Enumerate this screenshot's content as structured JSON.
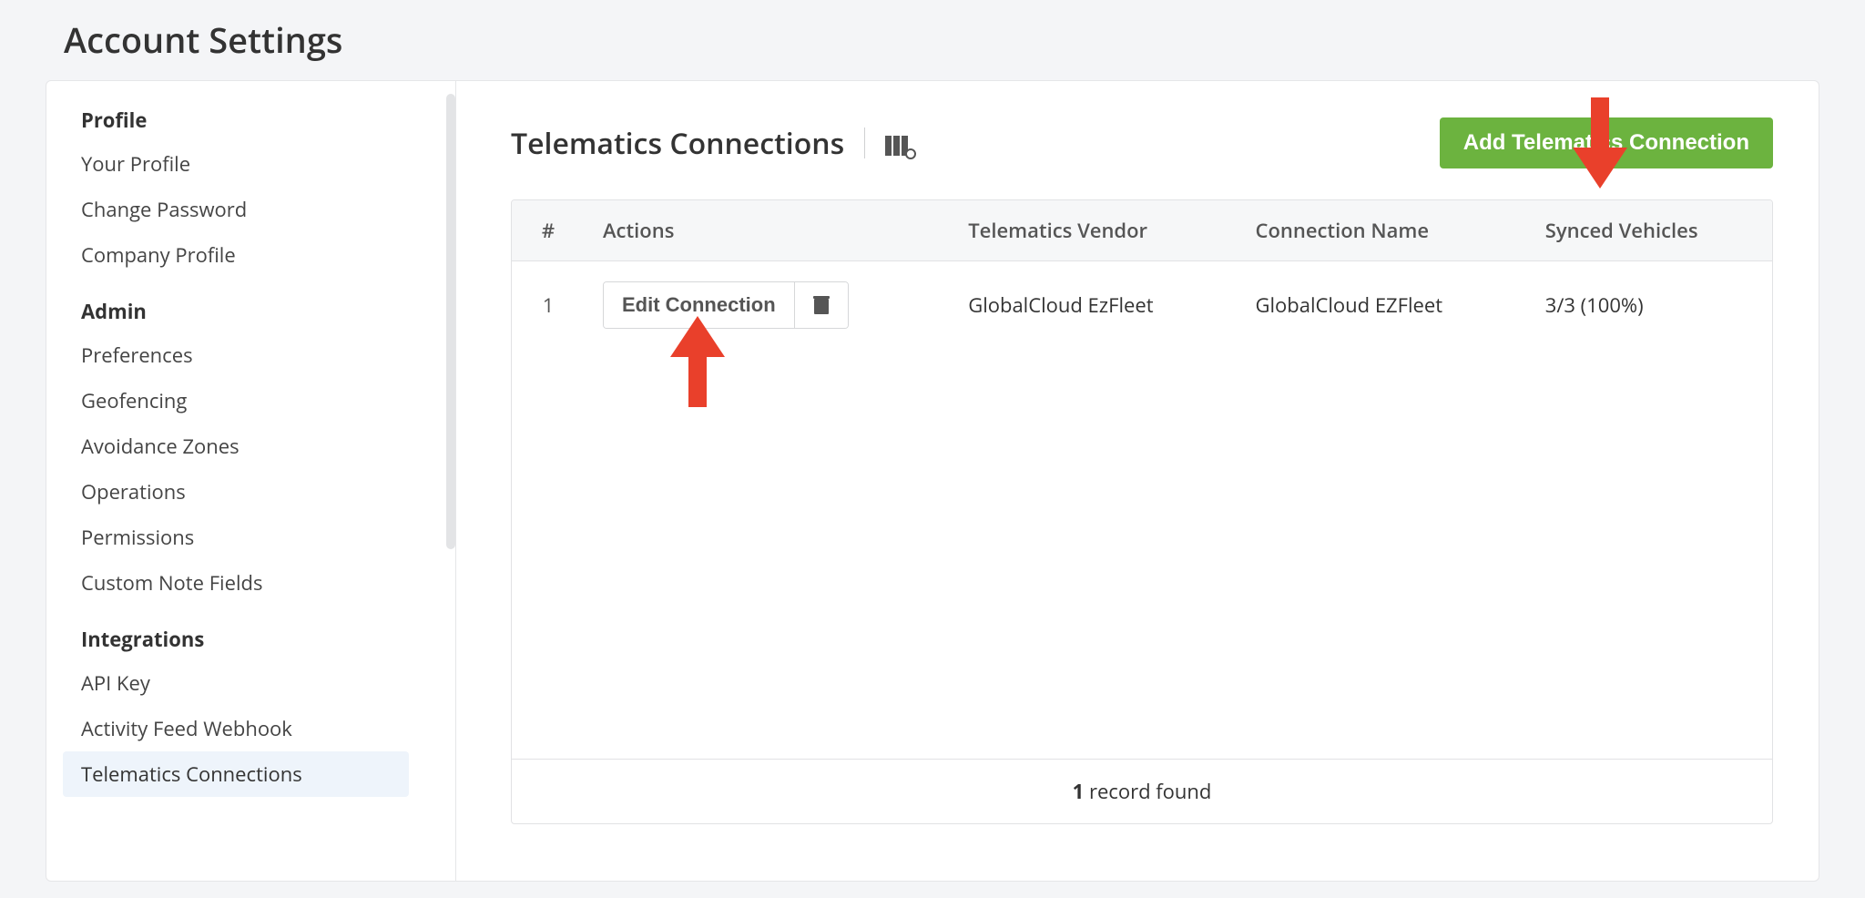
{
  "page_title": "Account Settings",
  "sidebar": {
    "groups": [
      {
        "heading": "Profile",
        "items": [
          {
            "label": "Your Profile",
            "name": "nav-your-profile",
            "active": false
          },
          {
            "label": "Change Password",
            "name": "nav-change-password",
            "active": false
          },
          {
            "label": "Company Profile",
            "name": "nav-company-profile",
            "active": false
          }
        ]
      },
      {
        "heading": "Admin",
        "items": [
          {
            "label": "Preferences",
            "name": "nav-preferences",
            "active": false
          },
          {
            "label": "Geofencing",
            "name": "nav-geofencing",
            "active": false
          },
          {
            "label": "Avoidance Zones",
            "name": "nav-avoidance-zones",
            "active": false
          },
          {
            "label": "Operations",
            "name": "nav-operations",
            "active": false
          },
          {
            "label": "Permissions",
            "name": "nav-permissions",
            "active": false
          },
          {
            "label": "Custom Note Fields",
            "name": "nav-custom-note-fields",
            "active": false
          }
        ]
      },
      {
        "heading": "Integrations",
        "items": [
          {
            "label": "API Key",
            "name": "nav-api-key",
            "active": false
          },
          {
            "label": "Activity Feed Webhook",
            "name": "nav-activity-feed-webhook",
            "active": false
          },
          {
            "label": "Telematics Connections",
            "name": "nav-telematics-connections",
            "active": true
          }
        ]
      }
    ]
  },
  "main": {
    "title": "Telematics Connections",
    "add_button": "Add Telematics Connection",
    "columns": {
      "num": "#",
      "actions": "Actions",
      "vendor": "Telematics Vendor",
      "connection_name": "Connection Name",
      "synced": "Synced Vehicles"
    },
    "rows": [
      {
        "num": "1",
        "edit_label": "Edit Connection",
        "vendor": "GlobalCloud EzFleet",
        "connection_name": "GlobalCloud EZFleet",
        "synced": "3/3 (100%)"
      }
    ],
    "footer_count": "1",
    "footer_text": " record found"
  },
  "annotations": {
    "arrow_down": "red-arrow-down",
    "arrow_up": "red-arrow-up"
  }
}
